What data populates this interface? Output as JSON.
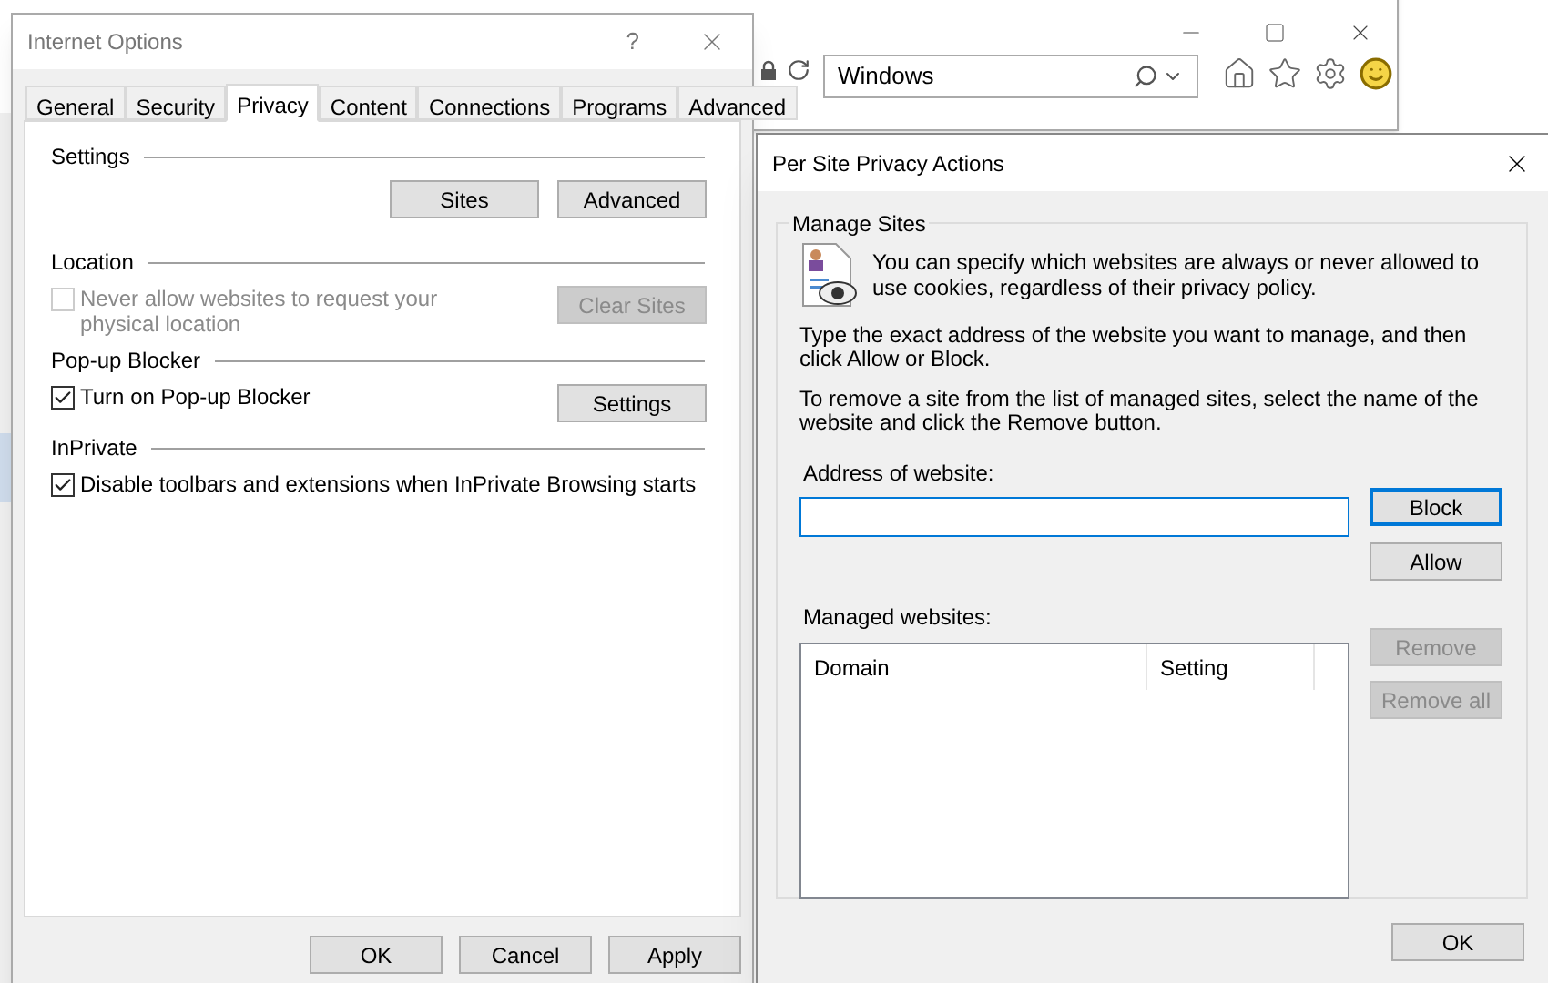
{
  "browser": {
    "search_value": "Windows"
  },
  "internet_options": {
    "title": "Internet Options",
    "help": "?",
    "tabs": [
      {
        "label": "General",
        "selected": false
      },
      {
        "label": "Security",
        "selected": false
      },
      {
        "label": "Privacy",
        "selected": true
      },
      {
        "label": "Content",
        "selected": false
      },
      {
        "label": "Connections",
        "selected": false
      },
      {
        "label": "Programs",
        "selected": false
      },
      {
        "label": "Advanced",
        "selected": false
      }
    ],
    "sections": [
      {
        "heading": "Settings",
        "buttons": [
          {
            "label": "Sites",
            "disabled": false
          },
          {
            "label": "Advanced",
            "disabled": false
          }
        ]
      },
      {
        "heading": "Location",
        "checkbox": {
          "label": "Never allow websites to request your physical location",
          "checked": false,
          "disabled": true
        },
        "buttons": [
          {
            "label": "Clear Sites",
            "disabled": true
          }
        ]
      },
      {
        "heading": "Pop-up Blocker",
        "checkbox": {
          "label": "Turn on Pop-up Blocker",
          "checked": true,
          "disabled": false
        },
        "buttons": [
          {
            "label": "Settings",
            "disabled": false
          }
        ]
      },
      {
        "heading": "InPrivate",
        "checkbox": {
          "label": "Disable toolbars and extensions when InPrivate Browsing starts",
          "checked": true,
          "disabled": false
        }
      }
    ],
    "buttons": [
      "OK",
      "Cancel",
      "Apply"
    ]
  },
  "per_site": {
    "title": "Per Site Privacy Actions",
    "group": "Manage Sites",
    "intro": "You can specify which websites are always or never allowed to use cookies, regardless of their privacy policy.",
    "instructions": [
      "Type the exact address of the website you want to manage, and then click Allow or Block.",
      "To remove a site from the list of managed sites, select the name of the website and click the Remove button."
    ],
    "address_label": "Address of website:",
    "address_buttons": [
      {
        "label": "Block",
        "default": true
      },
      {
        "label": "Allow",
        "default": false
      }
    ],
    "managed_label": "Managed websites:",
    "columns": [
      "Domain",
      "Setting"
    ],
    "list_buttons": [
      {
        "label": "Remove",
        "disabled": true
      },
      {
        "label": "Remove all",
        "disabled": true
      }
    ],
    "ok": "OK"
  }
}
